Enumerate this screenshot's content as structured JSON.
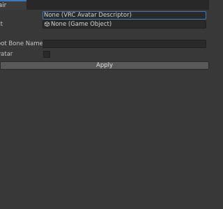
{
  "tab": {
    "label": "air"
  },
  "fields": {
    "avatar_descriptor": {
      "label": "",
      "value": "None (VRC Avatar Descriptor)"
    },
    "object": {
      "label": "ct",
      "value": "None (Game Object)"
    },
    "root_bone_name": {
      "label": "oot Bone Name",
      "value": ""
    },
    "avatar_toggle": {
      "label": "vatar",
      "checked": false
    }
  },
  "apply_button": {
    "label": "Apply"
  },
  "icons": {
    "object_field": "cube-icon"
  }
}
